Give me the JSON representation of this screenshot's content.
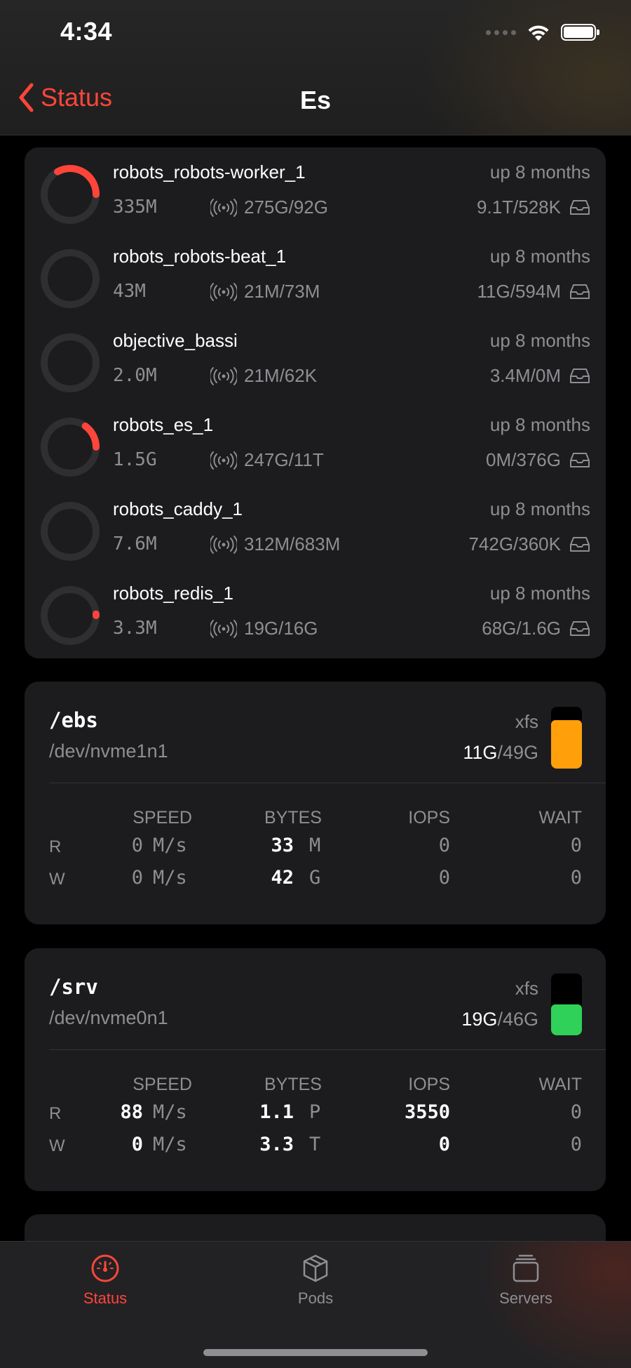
{
  "status_bar": {
    "time": "4:34"
  },
  "nav": {
    "back_label": "Status",
    "title": "Es"
  },
  "containers": [
    {
      "name": "robots_robots-worker_1",
      "uptime": "up 8 months",
      "mem": "335M",
      "net": "275G/92G",
      "io": "9.1T/528K",
      "cpu_fraction": 0.33
    },
    {
      "name": "robots_robots-beat_1",
      "uptime": "up 8 months",
      "mem": "43M",
      "net": "21M/73M",
      "io": "11G/594M",
      "cpu_fraction": 0
    },
    {
      "name": "objective_bassi",
      "uptime": "up 8 months",
      "mem": "2.0M",
      "net": "21M/62K",
      "io": "3.4M/0M",
      "cpu_fraction": 0
    },
    {
      "name": "robots_es_1",
      "uptime": "up 8 months",
      "mem": "1.5G",
      "net": "247G/11T",
      "io": "0M/376G",
      "cpu_fraction": 0.15
    },
    {
      "name": "robots_caddy_1",
      "uptime": "up 8 months",
      "mem": "7.6M",
      "net": "312M/683M",
      "io": "742G/360K",
      "cpu_fraction": 0
    },
    {
      "name": "robots_redis_1",
      "uptime": "up 8 months",
      "mem": "3.3M",
      "net": "19G/16G",
      "io": "68G/1.6G",
      "cpu_fraction": 0.01
    }
  ],
  "disk_headers": {
    "speed": "SPEED",
    "bytes": "BYTES",
    "iops": "IOPS",
    "wait": "WAIT"
  },
  "disks": [
    {
      "mount": "/ebs",
      "device": "/dev/nvme1n1",
      "fs": "xfs",
      "used": "11G",
      "slash": "/",
      "total": "49G",
      "used_fraction": 0.78,
      "color": "#ff9f0a",
      "rows": [
        {
          "label": "R",
          "speed": "0",
          "speed_unit": "M/s",
          "speed_hi": false,
          "bytes": "33",
          "bytes_unit": "M",
          "iops": "0",
          "iops_hi": false,
          "wait": "0"
        },
        {
          "label": "W",
          "speed": "0",
          "speed_unit": "M/s",
          "speed_hi": false,
          "bytes": "42",
          "bytes_unit": "G",
          "iops": "0",
          "iops_hi": false,
          "wait": "0"
        }
      ]
    },
    {
      "mount": "/srv",
      "device": "/dev/nvme0n1",
      "fs": "xfs",
      "used": "19G",
      "slash": "/",
      "total": "46G",
      "used_fraction": 0.5,
      "color": "#30d158",
      "rows": [
        {
          "label": "R",
          "speed": "88",
          "speed_unit": "M/s",
          "speed_hi": true,
          "bytes": "1.1",
          "bytes_unit": "P",
          "iops": "3550",
          "iops_hi": true,
          "wait": "0"
        },
        {
          "label": "W",
          "speed": "0",
          "speed_unit": "M/s",
          "speed_hi": true,
          "bytes": "3.3",
          "bytes_unit": "T",
          "iops": "0",
          "iops_hi": true,
          "wait": "0"
        }
      ]
    }
  ],
  "tabs": [
    {
      "label": "Status",
      "icon": "gauge-icon",
      "active": true
    },
    {
      "label": "Pods",
      "icon": "cube-icon",
      "active": false
    },
    {
      "label": "Servers",
      "icon": "stack-icon",
      "active": false
    }
  ],
  "colors": {
    "accent": "#ff453a",
    "card": "#1c1c1e",
    "muted": "#8e8e93"
  }
}
